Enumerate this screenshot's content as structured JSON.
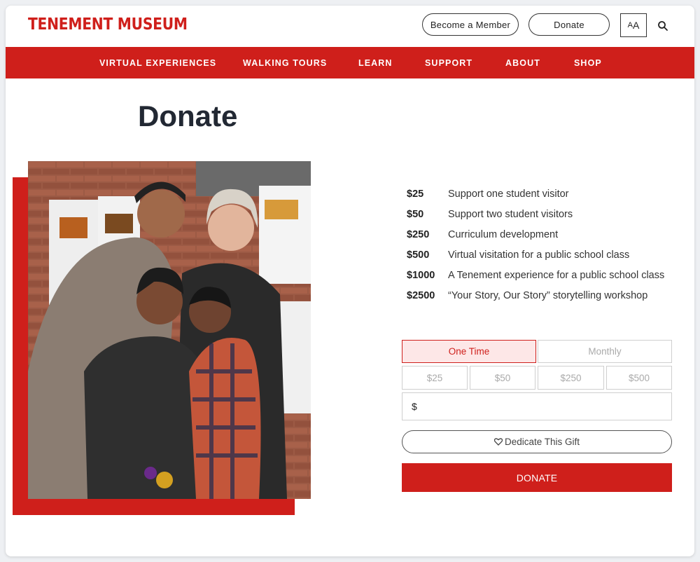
{
  "header": {
    "logo_text": "TENEMENT MUSEUM",
    "member_label": "Become a Member",
    "donate_label": "Donate",
    "text_size_big": "A",
    "text_size_small": "A"
  },
  "nav": {
    "items": [
      "VIRTUAL EXPERIENCES",
      "WALKING TOURS",
      "LEARN",
      "SUPPORT",
      "ABOUT",
      "SHOP"
    ]
  },
  "page": {
    "title": "Donate"
  },
  "giving_levels": [
    {
      "amount": "$25",
      "description": "Support one student visitor"
    },
    {
      "amount": "$50",
      "description": "Support two student visitors"
    },
    {
      "amount": "$250",
      "description": "Curriculum development"
    },
    {
      "amount": "$500",
      "description": "Virtual visitation for a public school class"
    },
    {
      "amount": "$1000",
      "description": "A Tenement experience for a public school class"
    },
    {
      "amount": "$2500",
      "description": "“Your Story, Our Story” storytelling workshop"
    }
  ],
  "form": {
    "frequency": [
      "One Time",
      "Monthly"
    ],
    "selected_frequency": "One Time",
    "preset_amounts": [
      "$25",
      "$50",
      "$250",
      "$500"
    ],
    "currency_symbol": "$",
    "custom_amount_value": "",
    "dedicate_label": "Dedicate This Gift",
    "submit_label": "DONATE"
  },
  "colors": {
    "brand_red": "#cf1f1b",
    "text_dark": "#222833",
    "active_bg": "#fde7e7"
  },
  "icons": {
    "search": "search-icon",
    "heart": "heart-icon"
  }
}
